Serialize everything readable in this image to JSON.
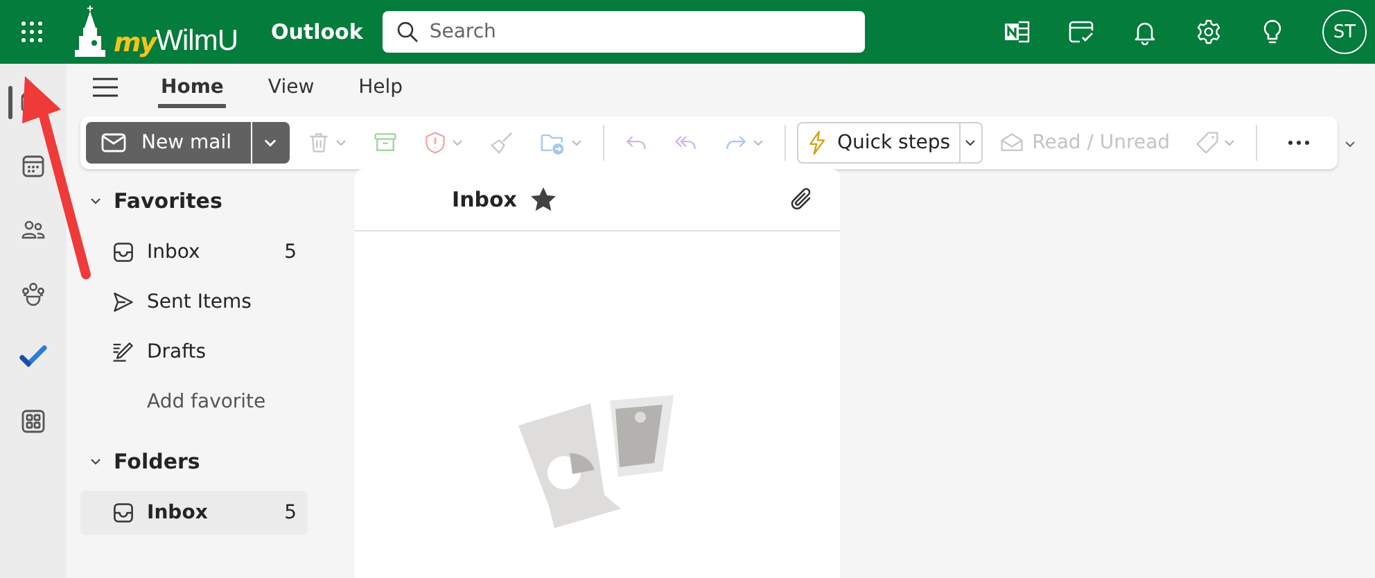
{
  "header": {
    "logo_prefix": "my",
    "logo_name": "WilmU",
    "app_name": "Outlook",
    "search": {
      "placeholder": "Search"
    },
    "avatar": "ST"
  },
  "rail": [
    {
      "kind": "mail",
      "selected": true
    },
    {
      "kind": "calendar",
      "selected": false
    },
    {
      "kind": "people",
      "selected": false
    },
    {
      "kind": "groups",
      "selected": false
    },
    {
      "kind": "todo",
      "selected": false
    },
    {
      "kind": "apps",
      "selected": false
    }
  ],
  "tabs": [
    {
      "label": "Home",
      "selected": true
    },
    {
      "label": "View",
      "selected": false
    },
    {
      "label": "Help",
      "selected": false
    }
  ],
  "ribbon": {
    "new_mail": "New mail",
    "quick_steps": "Quick steps",
    "read_unread": {
      "label": "Read / Unread",
      "disabled": true
    }
  },
  "folder_sections": [
    {
      "title": "Favorites",
      "expanded": true,
      "items": [
        {
          "kind": "inbox",
          "label": "Inbox",
          "count": "5",
          "selected": false
        },
        {
          "kind": "sent",
          "label": "Sent Items",
          "selected": false
        },
        {
          "kind": "drafts",
          "label": "Drafts",
          "selected": false
        },
        {
          "kind": "link",
          "label": "Add favorite",
          "selected": false
        }
      ]
    },
    {
      "title": "Folders",
      "expanded": true,
      "items": [
        {
          "kind": "inbox",
          "label": "Inbox",
          "count": "5",
          "selected": true
        }
      ]
    }
  ],
  "message_list": {
    "title": "Inbox",
    "favorite": true
  }
}
